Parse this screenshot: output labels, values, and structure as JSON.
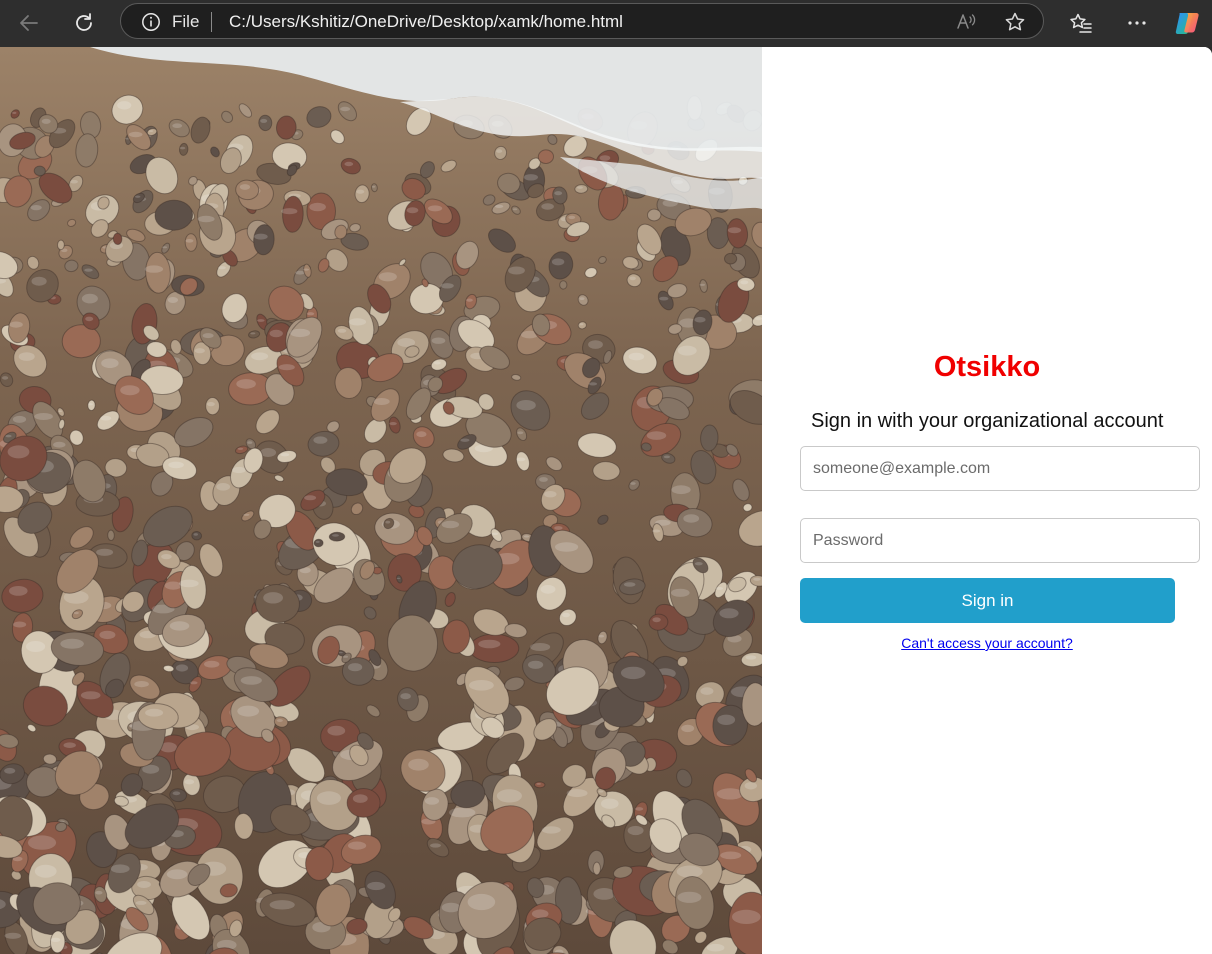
{
  "browser": {
    "scheme_label": "File",
    "url": "C:/Users/Kshitiz/OneDrive/Desktop/xamk/home.html"
  },
  "login": {
    "brand": "Otsikko",
    "subtitle": "Sign in with your organizational account",
    "email_placeholder": "someone@example.com",
    "password_placeholder": "Password",
    "signin_label": "Sign in",
    "help_link": "Can't access your account?"
  },
  "colors": {
    "brand": "#f00000",
    "signin_button": "#219fcb",
    "link": "#0000ee"
  }
}
